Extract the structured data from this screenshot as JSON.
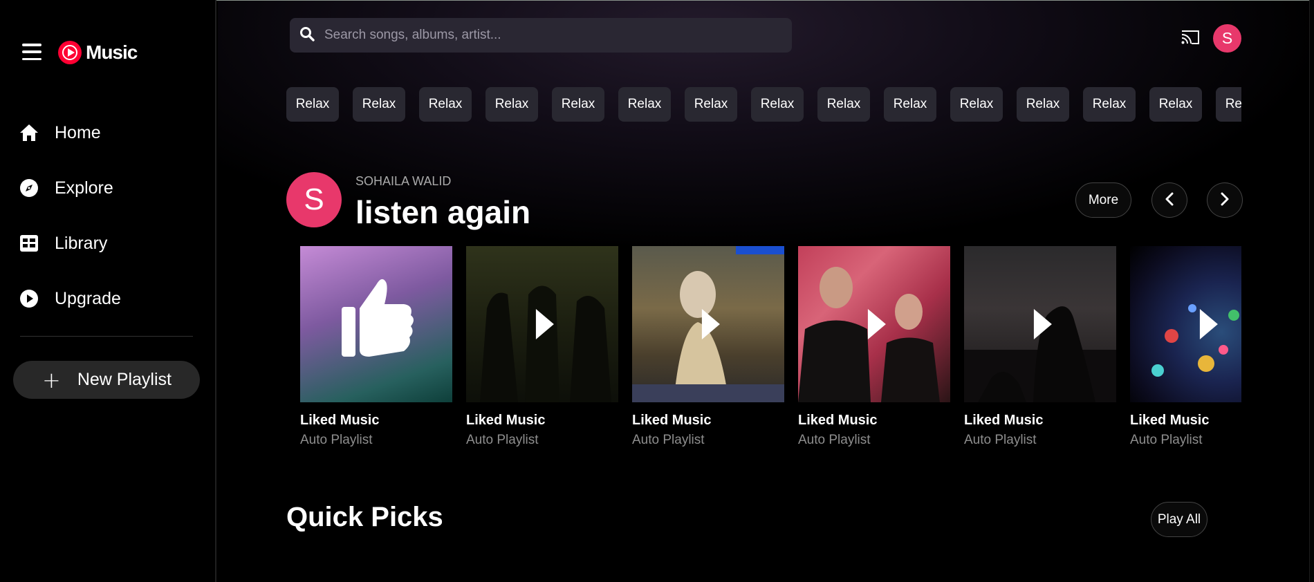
{
  "app": {
    "logo_text": "Music"
  },
  "sidebar": {
    "items": [
      {
        "label": "Home",
        "icon": "home-icon"
      },
      {
        "label": "Explore",
        "icon": "compass-icon"
      },
      {
        "label": "Library",
        "icon": "library-icon"
      },
      {
        "label": "Upgrade",
        "icon": "upgrade-icon"
      }
    ],
    "new_playlist_label": "New Playlist"
  },
  "header": {
    "search_placeholder": "Search songs, albums, artist...",
    "avatar_initial": "S"
  },
  "chips": [
    "Relax",
    "Relax",
    "Relax",
    "Relax",
    "Relax",
    "Relax",
    "Relax",
    "Relax",
    "Relax",
    "Relax",
    "Relax",
    "Relax",
    "Relax",
    "Relax",
    "Relax"
  ],
  "listen_again": {
    "avatar_initial": "S",
    "user_name": "SOHAILA WALID",
    "title": "listen again",
    "more_label": "More",
    "cards": [
      {
        "title": "Liked Music",
        "subtitle": "Auto Playlist"
      },
      {
        "title": "Liked Music",
        "subtitle": "Auto Playlist"
      },
      {
        "title": "Liked Music",
        "subtitle": "Auto Playlist"
      },
      {
        "title": "Liked Music",
        "subtitle": "Auto Playlist"
      },
      {
        "title": "Liked Music",
        "subtitle": "Auto Playlist"
      },
      {
        "title": "Liked Music",
        "subtitle": "Auto Playlist"
      }
    ]
  },
  "quick_picks": {
    "title": "Quick Picks",
    "play_all_label": "Play All"
  },
  "colors": {
    "accent": "#e8386b",
    "brand_red": "#ff0033",
    "chip_bg": "#292831"
  }
}
